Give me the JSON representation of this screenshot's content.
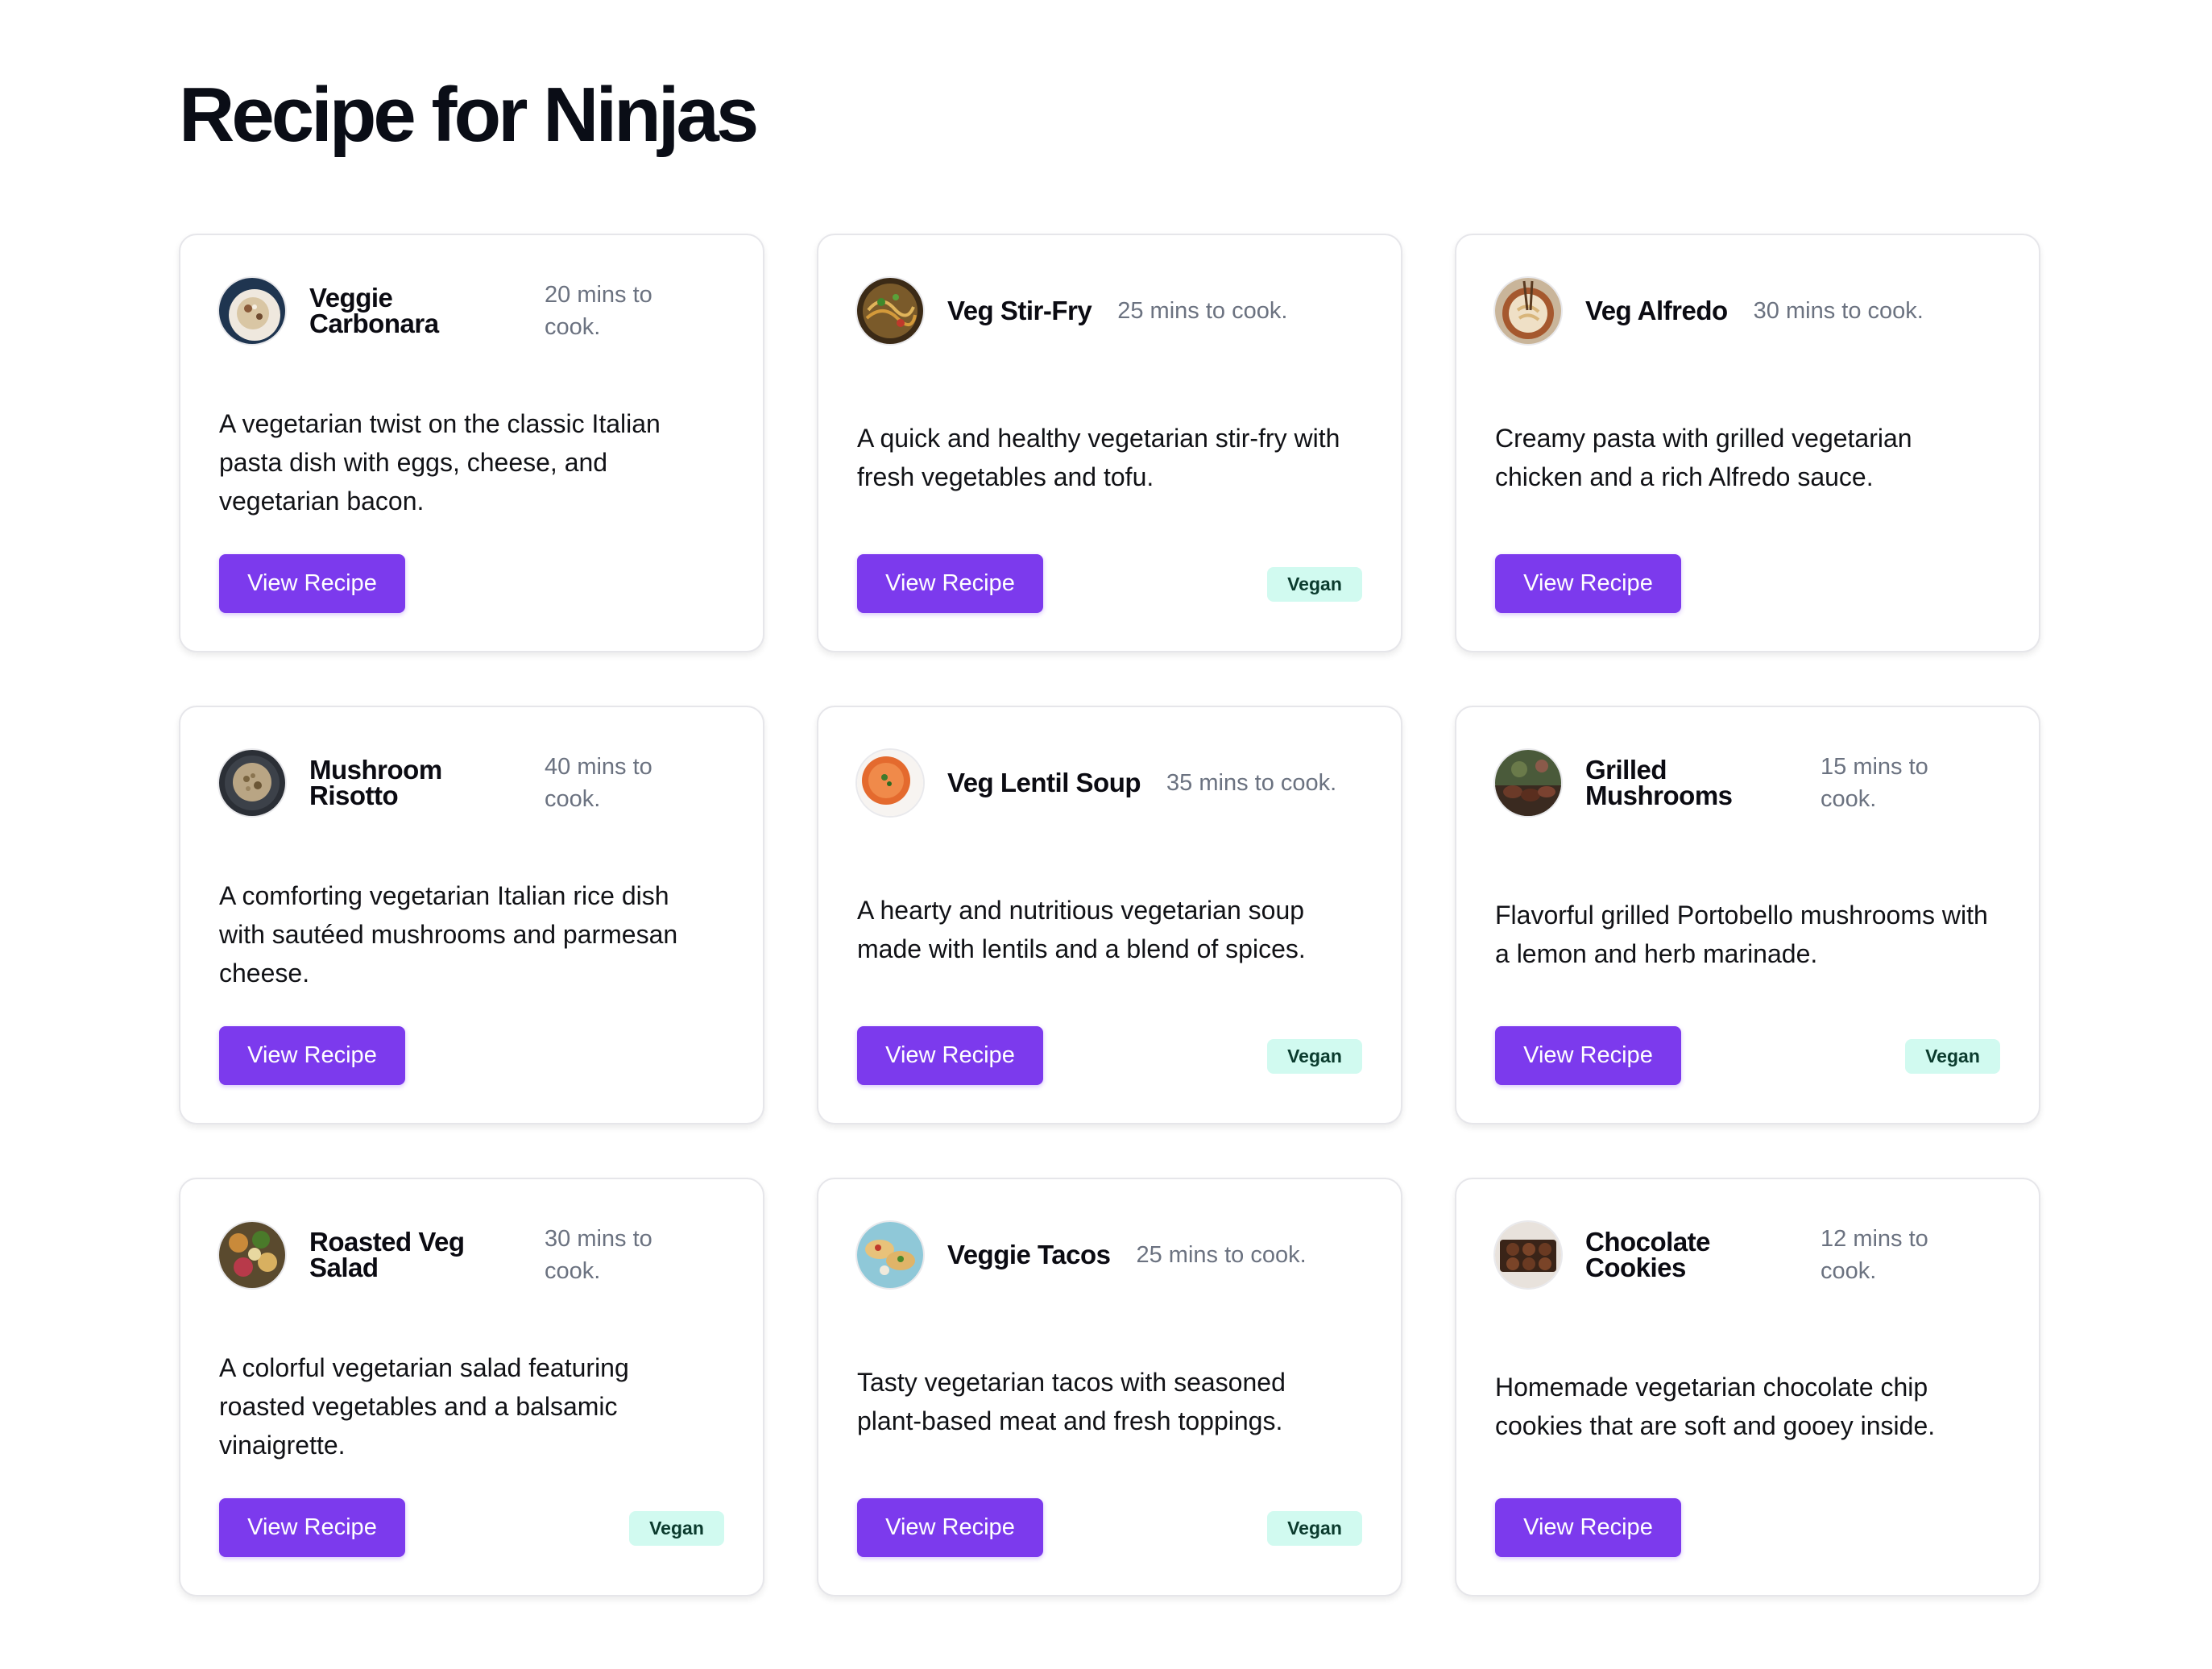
{
  "page_title": "Recipe for Ninjas",
  "colors": {
    "accent": "#7c3aed",
    "badge_bg": "#d1faf0",
    "muted": "#6b7280"
  },
  "recipes": [
    {
      "name": "Veggie Carbonara",
      "time": "20 mins to cook.",
      "description": "A vegetarian twist on the classic Italian pasta dish with eggs, cheese, and vegetarian bacon.",
      "button": "View Recipe",
      "badge": "",
      "icon": "carbonara-plate-icon"
    },
    {
      "name": "Veg Stir-Fry",
      "time": "25 mins to cook.",
      "description": "A quick and healthy vegetarian stir-fry with fresh vegetables and tofu.",
      "button": "View Recipe",
      "badge": "Vegan",
      "icon": "stir-fry-plate-icon"
    },
    {
      "name": "Veg Alfredo",
      "time": "30 mins to cook.",
      "description": "Creamy pasta with grilled vegetarian chicken and a rich Alfredo sauce.",
      "button": "View Recipe",
      "badge": "",
      "icon": "alfredo-bowl-icon"
    },
    {
      "name": "Mushroom Risotto",
      "time": "40 mins to cook.",
      "description": "A comforting vegetarian Italian rice dish with sautéed mushrooms and parmesan cheese.",
      "button": "View Recipe",
      "badge": "",
      "icon": "risotto-plate-icon"
    },
    {
      "name": "Veg Lentil Soup",
      "time": "35 mins to cook.",
      "description": "A hearty and nutritious vegetarian soup made with lentils and a blend of spices.",
      "button": "View Recipe",
      "badge": "Vegan",
      "icon": "soup-bowl-icon"
    },
    {
      "name": "Grilled Mushrooms",
      "time": "15 mins to cook.",
      "description": "Flavorful grilled Portobello mushrooms with a lemon and herb marinade.",
      "button": "View Recipe",
      "badge": "Vegan",
      "icon": "grilled-mushrooms-icon"
    },
    {
      "name": "Roasted Veg Salad",
      "time": "30 mins to cook.",
      "description": "A colorful vegetarian salad featuring roasted vegetables and a balsamic vinaigrette.",
      "button": "View Recipe",
      "badge": "Vegan",
      "icon": "salad-plate-icon"
    },
    {
      "name": "Veggie Tacos",
      "time": "25 mins to cook.",
      "description": "Tasty vegetarian tacos with seasoned plant-based meat and fresh toppings.",
      "button": "View Recipe",
      "badge": "Vegan",
      "icon": "tacos-plate-icon"
    },
    {
      "name": "Chocolate Cookies",
      "time": "12 mins to cook.",
      "description": "Homemade vegetarian chocolate chip cookies that are soft and gooey inside.",
      "button": "View Recipe",
      "badge": "",
      "icon": "cookies-tray-icon"
    }
  ]
}
